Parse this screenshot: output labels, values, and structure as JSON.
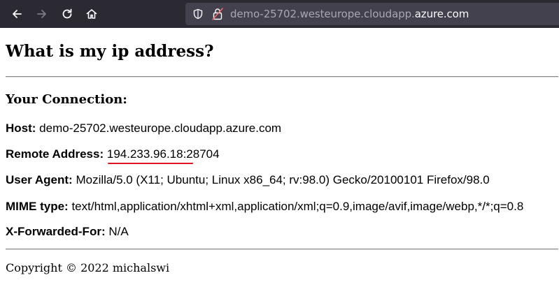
{
  "browser": {
    "url_subdomain": "demo-25702.westeurope.cloudapp.",
    "url_domain": "azure.com",
    "icons": {
      "back": "back-arrow-icon",
      "forward": "forward-arrow-icon",
      "reload": "reload-icon",
      "home": "home-icon",
      "tracking": "shield-icon",
      "security": "insecure-lock-icon"
    },
    "colors": {
      "toolbar": "#2b2a33",
      "urlbar": "#42414d"
    }
  },
  "page": {
    "title": "What is my ip address?",
    "section_heading": "Your Connection:",
    "host": {
      "label": "Host:",
      "value": "demo-25702.westeurope.cloudapp.azure.com"
    },
    "remote": {
      "label": "Remote Address:",
      "ip": "194.233.96.18:2",
      "port_rest": "8704"
    },
    "user_agent": {
      "label": "User Agent:",
      "value": "Mozilla/5.0 (X11; Ubuntu; Linux x86_64; rv:98.0) Gecko/20100101 Firefox/98.0"
    },
    "mime": {
      "label": "MIME type:",
      "value": "text/html,application/xhtml+xml,application/xml;q=0.9,image/avif,image/webp,*/*;q=0.8"
    },
    "xff": {
      "label": "X-Forwarded-For:",
      "value": "N/A"
    },
    "footer": "Copyright © 2022 michalswi",
    "annotation_color": "#e0141e"
  }
}
